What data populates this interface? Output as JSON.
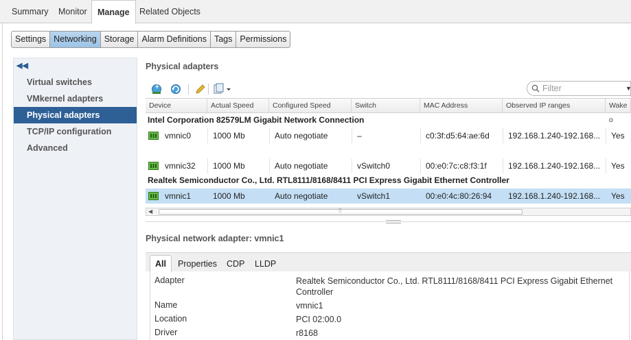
{
  "top_tabs": [
    "Summary",
    "Monitor",
    "Manage",
    "Related Objects"
  ],
  "sub_tabs": [
    "Settings",
    "Networking",
    "Storage",
    "Alarm Definitions",
    "Tags",
    "Permissions"
  ],
  "nav": {
    "collapse_icon": "double-chevron-left-icon",
    "items": [
      "Virtual switches",
      "VMkernel adapters",
      "Physical adapters",
      "TCP/IP configuration",
      "Advanced"
    ],
    "selected": "Physical adapters"
  },
  "section_title": "Physical adapters",
  "toolbar": {
    "icons": [
      "add-networking-icon",
      "refresh-icon",
      "edit-pencil-icon",
      "actions-menu-icon"
    ],
    "filter_placeholder": "Filter"
  },
  "table": {
    "columns": [
      "Device",
      "Actual Speed",
      "Configured Speed",
      "Switch",
      "MAC Address",
      "Observed IP ranges",
      "Wake o"
    ],
    "groups": [
      {
        "name": "Intel Corporation 82579LM Gigabit Network Connection",
        "rows": [
          [
            "vmnic0",
            "1000 Mb",
            "Auto negotiate",
            "–",
            "c0:3f:d5:64:ae:6d",
            "192.168.1.240-192.168...",
            "Yes"
          ],
          [
            "vmnic32",
            "1000 Mb",
            "Auto negotiate",
            "vSwitch0",
            "00:e0:7c:c8:f3:1f",
            "192.168.1.240-192.168...",
            "Yes"
          ]
        ]
      },
      {
        "name": "Realtek Semiconductor Co., Ltd. RTL8111/8168/8411 PCI Express Gigabit Ethernet Controller",
        "rows": [
          [
            "vmnic1",
            "1000 Mb",
            "Auto negotiate",
            "vSwitch1",
            "00:e0:4c:80:26:94",
            "192.168.1.240-192.168...",
            "Yes"
          ]
        ]
      }
    ],
    "selected_device": "vmnic1"
  },
  "detail": {
    "title": "Physical network adapter: vmnic1",
    "tabs": [
      "All",
      "Properties",
      "CDP",
      "LLDP"
    ],
    "active_tab": "All",
    "props": [
      {
        "label": "Adapter",
        "value": "Realtek Semiconductor Co., Ltd. RTL8111/8168/8411 PCI Express Gigabit Ethernet",
        "value2": "Controller"
      },
      {
        "label": "Name",
        "value": "vmnic1"
      },
      {
        "label": "Location",
        "value": "PCI 02:00.0"
      },
      {
        "label": "Driver",
        "value": "r8168"
      }
    ]
  },
  "colors": {
    "accent": "#2e6096",
    "selected_row": "#c4dff5",
    "tab_active": "#9cc3e6"
  }
}
